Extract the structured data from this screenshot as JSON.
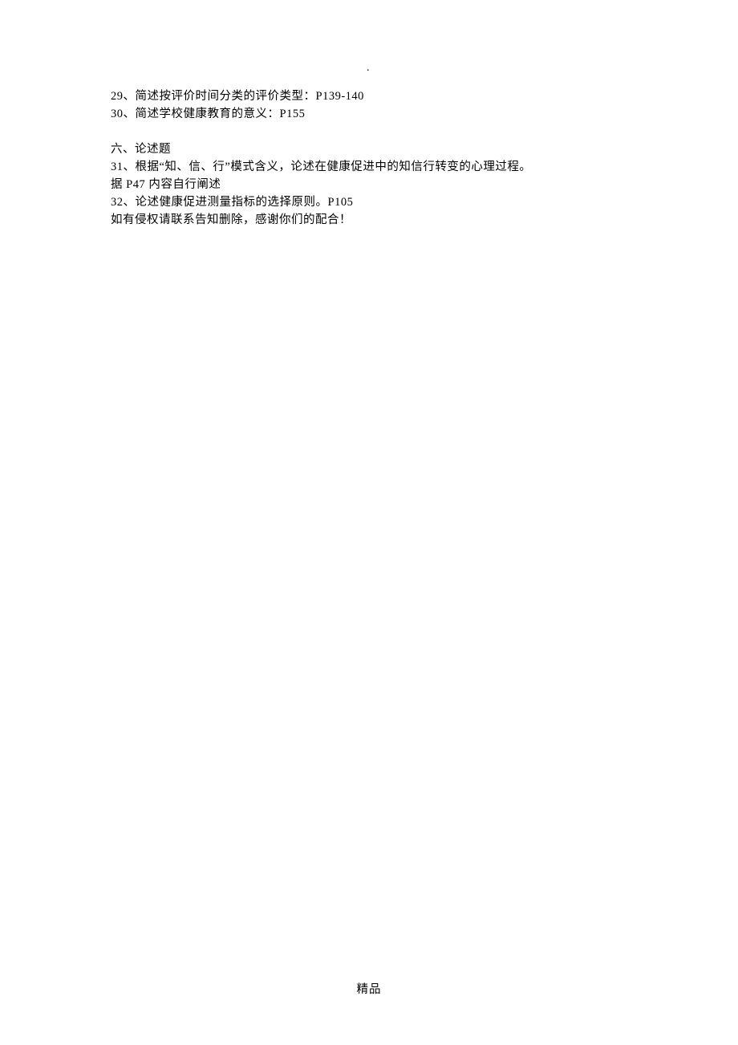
{
  "header_mark": ".",
  "lines": {
    "q29": "29、简述按评价时间分类的评价类型：P139-140",
    "q30": "30、简述学校健康教育的意义：P155",
    "section6_title": "六、论述题",
    "q31": "31、根据“知、信、行”模式含义，论述在健康促进中的知信行转变的心理过程。",
    "q31_note": "据 P47 内容自行阐述",
    "q32": "32、论述健康促进测量指标的选择原则。P105",
    "copyright_notice": "如有侵权请联系告知删除，感谢你们的配合！"
  },
  "footer": "精品"
}
